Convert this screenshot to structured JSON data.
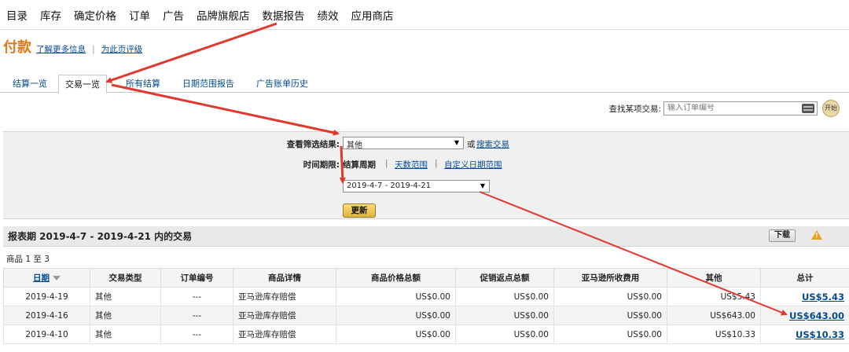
{
  "nav": {
    "items": [
      "目录",
      "库存",
      "确定价格",
      "订单",
      "广告",
      "品牌旗舰店",
      "数据报告",
      "绩效",
      "应用商店"
    ]
  },
  "header": {
    "title": "付款",
    "learn_more": "了解更多信息",
    "rate_page": "为此页评级"
  },
  "tabs": {
    "items": [
      {
        "label": "结算一览",
        "active": false
      },
      {
        "label": "交易一览",
        "active": true
      },
      {
        "label": "所有结算",
        "active": false
      },
      {
        "label": "日期范围报告",
        "active": false
      },
      {
        "label": "广告账单历史",
        "active": false
      }
    ]
  },
  "search": {
    "label": "查找某项交易:",
    "placeholder": "输入订单编号",
    "go_label": "开始"
  },
  "filters": {
    "view_label": "查看筛选结果:",
    "view_value": "其他",
    "or_text": "或",
    "search_tx_link": "搜索交易",
    "period_label": "时间期限:",
    "settlement_period": "结算周期",
    "sep": "|",
    "days_range": "天数范围",
    "custom_range": "自定义日期范围",
    "period_value": "2019-4-7 - 2019-4-21",
    "update_button": "更新"
  },
  "report": {
    "title": "报表期 2019-4-7 - 2019-4-21 内的交易",
    "download_button": "下载",
    "count_text": "商品 1 至 3"
  },
  "table": {
    "columns": [
      "日期",
      "交易类型",
      "订单编号",
      "商品详情",
      "商品价格总额",
      "促销返点总额",
      "亚马逊所收费用",
      "其他",
      "总计"
    ],
    "rows": [
      {
        "date": "2019-4-19",
        "type": "其他",
        "order": "---",
        "detail": "亚马逊库存赔偿",
        "price": "US$0.00",
        "promo": "US$0.00",
        "fees": "US$0.00",
        "other": "US$5.43",
        "total": "US$5.43"
      },
      {
        "date": "2019-4-16",
        "type": "其他",
        "order": "---",
        "detail": "亚马逊库存赔偿",
        "price": "US$0.00",
        "promo": "US$0.00",
        "fees": "US$0.00",
        "other": "US$643.00",
        "total": "US$643.00"
      },
      {
        "date": "2019-4-10",
        "type": "其他",
        "order": "---",
        "detail": "亚马逊库存赔偿",
        "price": "US$0.00",
        "promo": "US$0.00",
        "fees": "US$0.00",
        "other": "US$10.33",
        "total": "US$10.33"
      }
    ]
  },
  "colors": {
    "title_orange": "#e47911",
    "link_blue": "#004b91",
    "annotation_red": "#e0382e"
  }
}
